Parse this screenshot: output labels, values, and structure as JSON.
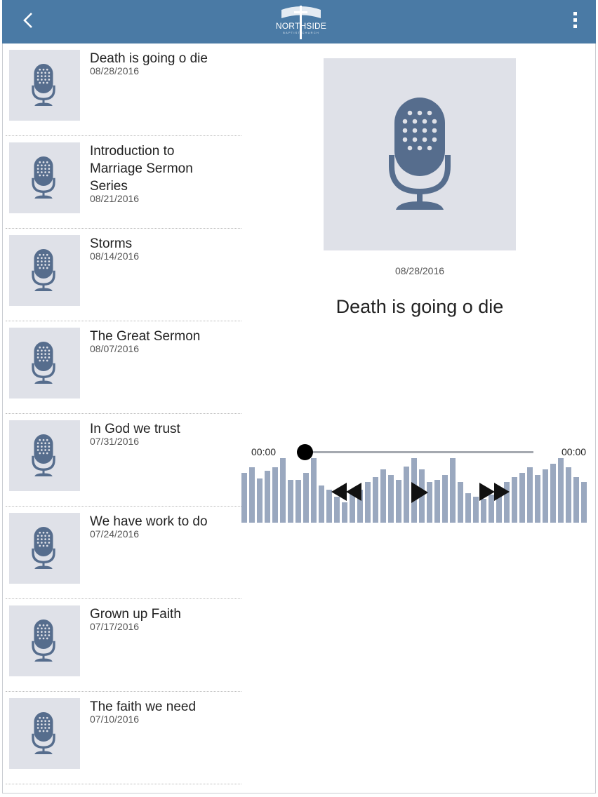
{
  "header": {
    "logo_text": "NORTHSIDE",
    "logo_subtext": "BAPTIST CHURCH",
    "bar_color": "#4a7aa5",
    "back_icon": "chevron-left-icon",
    "menu_icon": "more-vertical-icon"
  },
  "sermons": [
    {
      "title": "Death is going o die",
      "date": "08/28/2016"
    },
    {
      "title": "Introduction to Marriage Sermon Series",
      "date": "08/21/2016"
    },
    {
      "title": "Storms",
      "date": "08/14/2016"
    },
    {
      "title": "The Great Sermon",
      "date": "08/07/2016"
    },
    {
      "title": "In God we trust",
      "date": "07/31/2016"
    },
    {
      "title": "We have work to do",
      "date": "07/24/2016"
    },
    {
      "title": "Grown up Faith",
      "date": "07/17/2016"
    },
    {
      "title": "The faith we need",
      "date": "07/10/2016"
    }
  ],
  "player": {
    "date": "08/28/2016",
    "title": "Death is going o die",
    "elapsed": "00:00",
    "duration": "00:00",
    "progress": 0,
    "icons": {
      "rewind": "rewind-icon",
      "play": "play-icon",
      "forward": "fast-forward-icon"
    },
    "waveform_levels": [
      0.68,
      0.75,
      0.6,
      0.7,
      0.75,
      0.88,
      0.58,
      0.58,
      0.68,
      0.88,
      0.5,
      0.45,
      0.35,
      0.28,
      0.4,
      0.45,
      0.55,
      0.62,
      0.72,
      0.65,
      0.58,
      0.76,
      0.88,
      0.72,
      0.55,
      0.58,
      0.65,
      0.88,
      0.55,
      0.4,
      0.35,
      0.32,
      0.38,
      0.45,
      0.55,
      0.62,
      0.68,
      0.75,
      0.65,
      0.72,
      0.8,
      0.88,
      0.75,
      0.62,
      0.55
    ]
  }
}
